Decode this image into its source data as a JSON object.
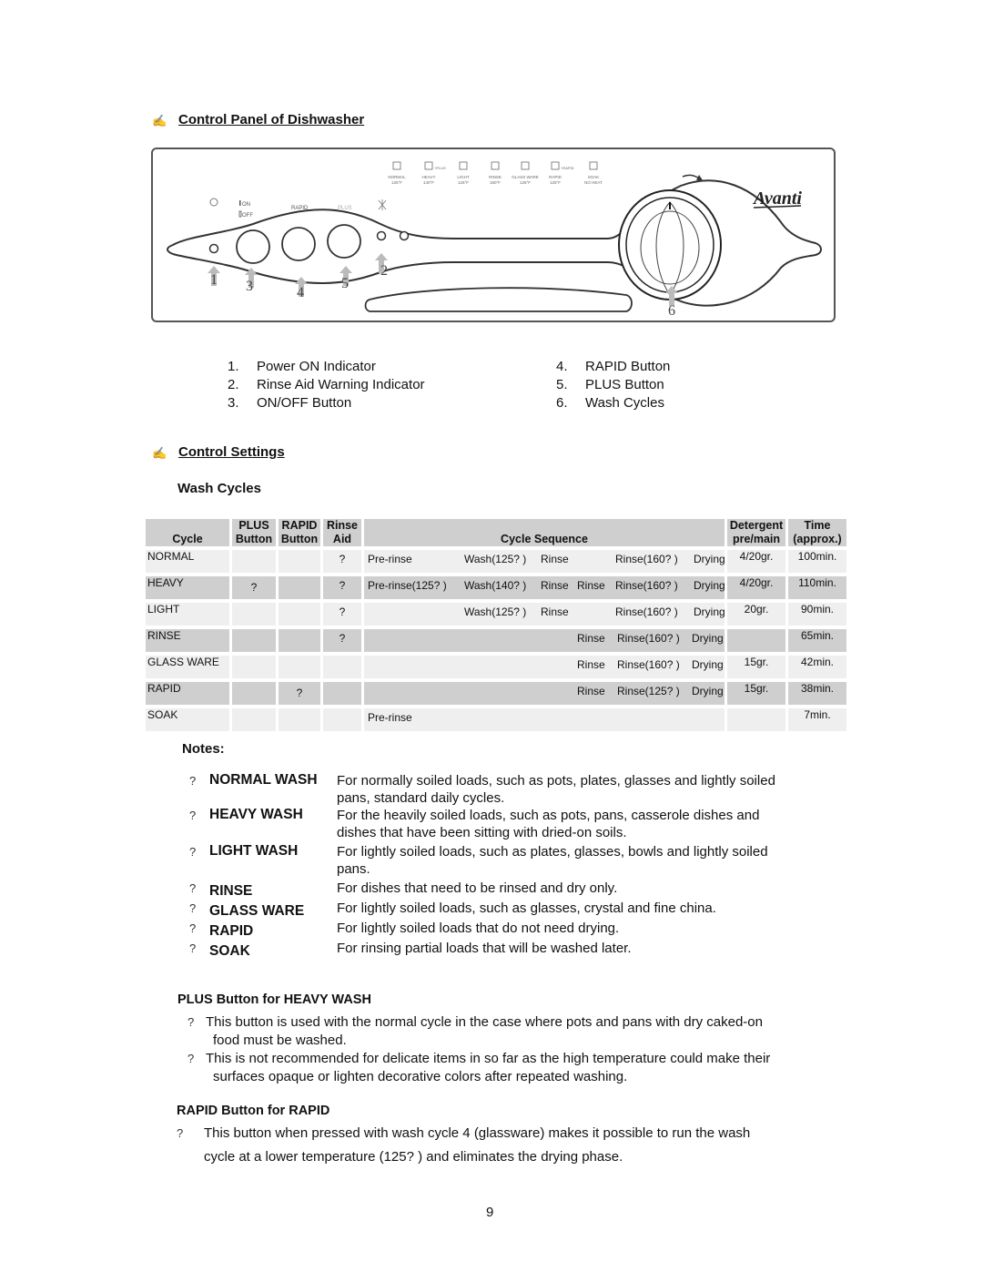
{
  "section1": {
    "bullet_icon": "pen-icon",
    "title": "Control Panel of Dishwasher"
  },
  "panel": {
    "brand": "Avanti",
    "cycle_icons": [
      {
        "name": "NORMAL",
        "temp": "125°F"
      },
      {
        "name": "HEAVY",
        "temp": "140°F",
        "extra": "+PLUS"
      },
      {
        "name": "LIGHT",
        "temp": "125°F"
      },
      {
        "name": "RINSE",
        "temp": "160°F"
      },
      {
        "name": "GLASS WARE",
        "temp": "125°F"
      },
      {
        "name": "RAPID",
        "temp": "125°F",
        "extra": "+RAPID"
      },
      {
        "name": "SOAK",
        "temp": "NO HEAT"
      }
    ],
    "on_label": "ON",
    "off_label": "OFF",
    "rapid_label": "RAPID",
    "plus_label": "PLUS",
    "callouts": [
      "1",
      "2",
      "3",
      "4",
      "5",
      "6"
    ]
  },
  "legend": {
    "left": [
      {
        "num": "1.",
        "label": "Power ON Indicator"
      },
      {
        "num": "2.",
        "label": "Rinse Aid Warning Indicator"
      },
      {
        "num": "3.",
        "label": "ON/OFF Button"
      }
    ],
    "right": [
      {
        "num": "4.",
        "label": "RAPID Button"
      },
      {
        "num": "5.",
        "label": "PLUS Button"
      },
      {
        "num": "6.",
        "label": "Wash Cycles"
      }
    ]
  },
  "section2": {
    "bullet_icon": "pen-icon",
    "title": "Control Settings",
    "subtitle": "Wash Cycles"
  },
  "table": {
    "headers": {
      "cycle": "Cycle",
      "plus": [
        "PLUS",
        "Button"
      ],
      "rapid": [
        "RAPID",
        "Button"
      ],
      "aid": [
        "Rinse",
        "Aid"
      ],
      "seq": "Cycle Sequence",
      "det": [
        "Detergent",
        "pre/main"
      ],
      "time": [
        "Time",
        "(approx.)"
      ]
    },
    "rows": [
      {
        "cycle": "NORMAL",
        "plus": "",
        "rapid": "",
        "aid": "?",
        "seq": [
          "Pre-rinse",
          "Wash(125? )",
          "Rinse",
          "",
          "Rinse(160? )",
          "Drying"
        ],
        "det": "4/20gr.",
        "time": "100min."
      },
      {
        "cycle": "HEAVY",
        "plus": "?",
        "rapid": "",
        "aid": "?",
        "seq": [
          "Pre-rinse(125? )",
          "Wash(140? )",
          "Rinse",
          "Rinse",
          "Rinse(160? )",
          "Drying"
        ],
        "det": "4/20gr.",
        "time": "110min."
      },
      {
        "cycle": "LIGHT",
        "plus": "",
        "rapid": "",
        "aid": "?",
        "seq": [
          "",
          "Wash(125? )",
          "Rinse",
          "",
          "Rinse(160? )",
          "Drying"
        ],
        "det": "20gr.",
        "time": "90min."
      },
      {
        "cycle": "RINSE",
        "plus": "",
        "rapid": "",
        "aid": "?",
        "seq": [
          "",
          "",
          "",
          "Rinse",
          "Rinse(160? )",
          "Drying"
        ],
        "det": "",
        "time": "65min."
      },
      {
        "cycle": "GLASS WARE",
        "plus": "",
        "rapid": "",
        "aid": "",
        "seq": [
          "",
          "",
          "",
          "Rinse",
          "Rinse(160? )",
          "Drying"
        ],
        "det": "15gr.",
        "time": "42min."
      },
      {
        "cycle": "RAPID",
        "plus": "",
        "rapid": "?",
        "aid": "",
        "seq": [
          "",
          "",
          "",
          "Rinse",
          "Rinse(125? )",
          "Drying"
        ],
        "det": "15gr.",
        "time": "38min."
      },
      {
        "cycle": "SOAK",
        "plus": "",
        "rapid": "",
        "aid": "",
        "seq": [
          "Pre-rinse",
          "",
          "",
          "",
          "",
          ""
        ],
        "det": "",
        "time": "7min."
      }
    ]
  },
  "notes": {
    "title": "Notes:",
    "items": [
      {
        "bullet": "?",
        "key": "NORMAL WASH",
        "lines": [
          "For normally soiled loads, such as pots, plates, glasses and lightly soiled",
          "pans, standard daily cycles."
        ]
      },
      {
        "bullet": "?",
        "key": "HEAVY WASH",
        "lines": [
          "For the heavily soiled loads, such as pots, pans, casserole dishes and",
          "dishes that have been sitting with dried-on soils."
        ]
      },
      {
        "bullet": "?",
        "key": "LIGHT WASH",
        "lines": [
          "For lightly soiled loads, such as plates, glasses, bowls and lightly soiled",
          "pans."
        ]
      },
      {
        "bullet": "?",
        "key": "RINSE",
        "lines": [
          "For dishes that need to be rinsed and dry only."
        ]
      },
      {
        "bullet": "?",
        "key": "GLASS WARE",
        "lines": [
          "For lightly soiled loads, such as glasses, crystal and fine china."
        ]
      },
      {
        "bullet": "?",
        "key": "RAPID",
        "lines": [
          "For lightly soiled loads that do not need drying."
        ]
      },
      {
        "bullet": "?",
        "key": "SOAK",
        "lines": [
          "For rinsing partial loads that will be washed later."
        ]
      }
    ]
  },
  "plus_section": {
    "title": "PLUS Button for HEAVY WASH",
    "items": [
      {
        "bullet": "?",
        "lines": [
          "This button is used with the normal cycle in the case where pots and pans with dry caked-on",
          "food must be washed."
        ]
      },
      {
        "bullet": "?",
        "lines": [
          "This is not recommended for delicate items in so far as the high temperature could make their",
          "surfaces opaque or lighten decorative colors after repeated washing."
        ]
      }
    ]
  },
  "rapid_section": {
    "title": "RAPID Button for RAPID",
    "items": [
      {
        "bullet": "?",
        "lines": [
          "This button when pressed with wash cycle 4 (glassware) makes it possible to run the wash",
          "cycle at a lower temperature (125?  ) and eliminates the drying phase."
        ]
      }
    ]
  },
  "page_number": "9"
}
